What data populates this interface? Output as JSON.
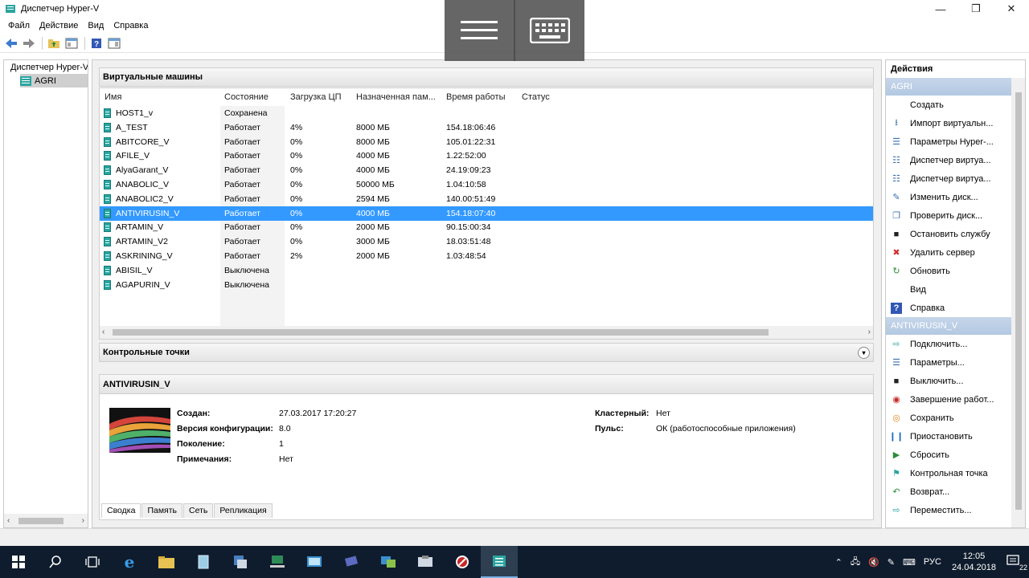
{
  "window": {
    "title": "Диспетчер Hyper-V",
    "minimize": "—",
    "maximize": "❐",
    "close": "✕"
  },
  "menu": [
    "Файл",
    "Действие",
    "Вид",
    "Справка"
  ],
  "tree": {
    "root": "Диспетчер Hyper-V",
    "child": "AGRI"
  },
  "vms_panel": {
    "title": "Виртуальные машины",
    "columns": [
      "Имя",
      "Состояние",
      "Загрузка ЦП",
      "Назначенная пам...",
      "Время работы",
      "Статус"
    ],
    "rows": [
      {
        "name": "HOST1_v",
        "state": "Сохранена",
        "cpu": "",
        "mem": "",
        "uptime": ""
      },
      {
        "name": "A_TEST",
        "state": "Работает",
        "cpu": "4%",
        "mem": "8000 МБ",
        "uptime": "154.18:06:46"
      },
      {
        "name": "ABITCORE_V",
        "state": "Работает",
        "cpu": "0%",
        "mem": "8000 МБ",
        "uptime": "105.01:22:31"
      },
      {
        "name": "AFILE_V",
        "state": "Работает",
        "cpu": "0%",
        "mem": "4000 МБ",
        "uptime": "1.22:52:00"
      },
      {
        "name": "AlyaGarant_V",
        "state": "Работает",
        "cpu": "0%",
        "mem": "4000 МБ",
        "uptime": "24.19:09:23"
      },
      {
        "name": "ANABOLIC_V",
        "state": "Работает",
        "cpu": "0%",
        "mem": "50000 МБ",
        "uptime": "1.04:10:58"
      },
      {
        "name": "ANABOLIC2_V",
        "state": "Работает",
        "cpu": "0%",
        "mem": "2594 МБ",
        "uptime": "140.00:51:49"
      },
      {
        "name": "ANTIVIRUSIN_V",
        "state": "Работает",
        "cpu": "0%",
        "mem": "4000 МБ",
        "uptime": "154.18:07:40"
      },
      {
        "name": "ARTAMIN_V",
        "state": "Работает",
        "cpu": "0%",
        "mem": "2000 МБ",
        "uptime": "90.15:00:34"
      },
      {
        "name": "ARTAMIN_V2",
        "state": "Работает",
        "cpu": "0%",
        "mem": "3000 МБ",
        "uptime": "18.03:51:48"
      },
      {
        "name": "ASKRINING_V",
        "state": "Работает",
        "cpu": "2%",
        "mem": "2000 МБ",
        "uptime": "1.03:48:54"
      },
      {
        "name": "ABISIL_V",
        "state": "Выключена",
        "cpu": "",
        "mem": "",
        "uptime": ""
      },
      {
        "name": "AGAPURIN_V",
        "state": "Выключена",
        "cpu": "",
        "mem": "",
        "uptime": ""
      }
    ],
    "selected_index": 7
  },
  "checkpoints": {
    "title": "Контрольные точки"
  },
  "details": {
    "title": "ANTIVIRUSIN_V",
    "created_label": "Создан:",
    "created": "27.03.2017 17:20:27",
    "config_label": "Версия конфигурации:",
    "config": "8.0",
    "gen_label": "Поколение:",
    "gen": "1",
    "notes_label": "Примечания:",
    "notes": "Нет",
    "cluster_label": "Кластерный:",
    "cluster": "Нет",
    "pulse_label": "Пульс:",
    "pulse": "ОК (работоспособные приложения)",
    "tabs": [
      "Сводка",
      "Память",
      "Сеть",
      "Репликация"
    ]
  },
  "actions": {
    "title": "Действия",
    "section1": "AGRI",
    "items1": [
      {
        "label": "Создать",
        "icon": "blank-icon",
        "sub": true
      },
      {
        "label": "Импорт виртуальн...",
        "icon": "import-icon"
      },
      {
        "label": "Параметры Hyper-...",
        "icon": "settings-doc-icon"
      },
      {
        "label": "Диспетчер виртуа...",
        "icon": "switch-manager-icon"
      },
      {
        "label": "Диспетчер виртуа...",
        "icon": "san-manager-icon"
      },
      {
        "label": "Изменить диск...",
        "icon": "edit-disk-icon"
      },
      {
        "label": "Проверить диск...",
        "icon": "inspect-disk-icon"
      },
      {
        "label": "Остановить службу",
        "icon": "stop-service-icon"
      },
      {
        "label": "Удалить сервер",
        "icon": "remove-server-icon"
      },
      {
        "label": "Обновить",
        "icon": "refresh-icon"
      },
      {
        "label": "Вид",
        "icon": "blank-icon",
        "sub": true
      },
      {
        "label": "Справка",
        "icon": "help-icon"
      }
    ],
    "section2": "ANTIVIRUSIN_V",
    "items2": [
      {
        "label": "Подключить...",
        "icon": "connect-icon"
      },
      {
        "label": "Параметры...",
        "icon": "settings-icon"
      },
      {
        "label": "Выключить...",
        "icon": "turn-off-icon"
      },
      {
        "label": "Завершение работ...",
        "icon": "shutdown-icon"
      },
      {
        "label": "Сохранить",
        "icon": "save-icon"
      },
      {
        "label": "Приостановить",
        "icon": "pause-icon"
      },
      {
        "label": "Сбросить",
        "icon": "reset-icon"
      },
      {
        "label": "Контрольная точка",
        "icon": "checkpoint-icon"
      },
      {
        "label": "Возврат...",
        "icon": "revert-icon"
      },
      {
        "label": "Переместить...",
        "icon": "move-icon"
      }
    ]
  },
  "taskbar": {
    "lang": "РУС",
    "time": "12:05",
    "date": "24.04.2018",
    "notifications": "22"
  },
  "colors": {
    "selection": "#3399ff",
    "action_section": "#b3c8e2",
    "taskbar": "#0f1c2d"
  }
}
